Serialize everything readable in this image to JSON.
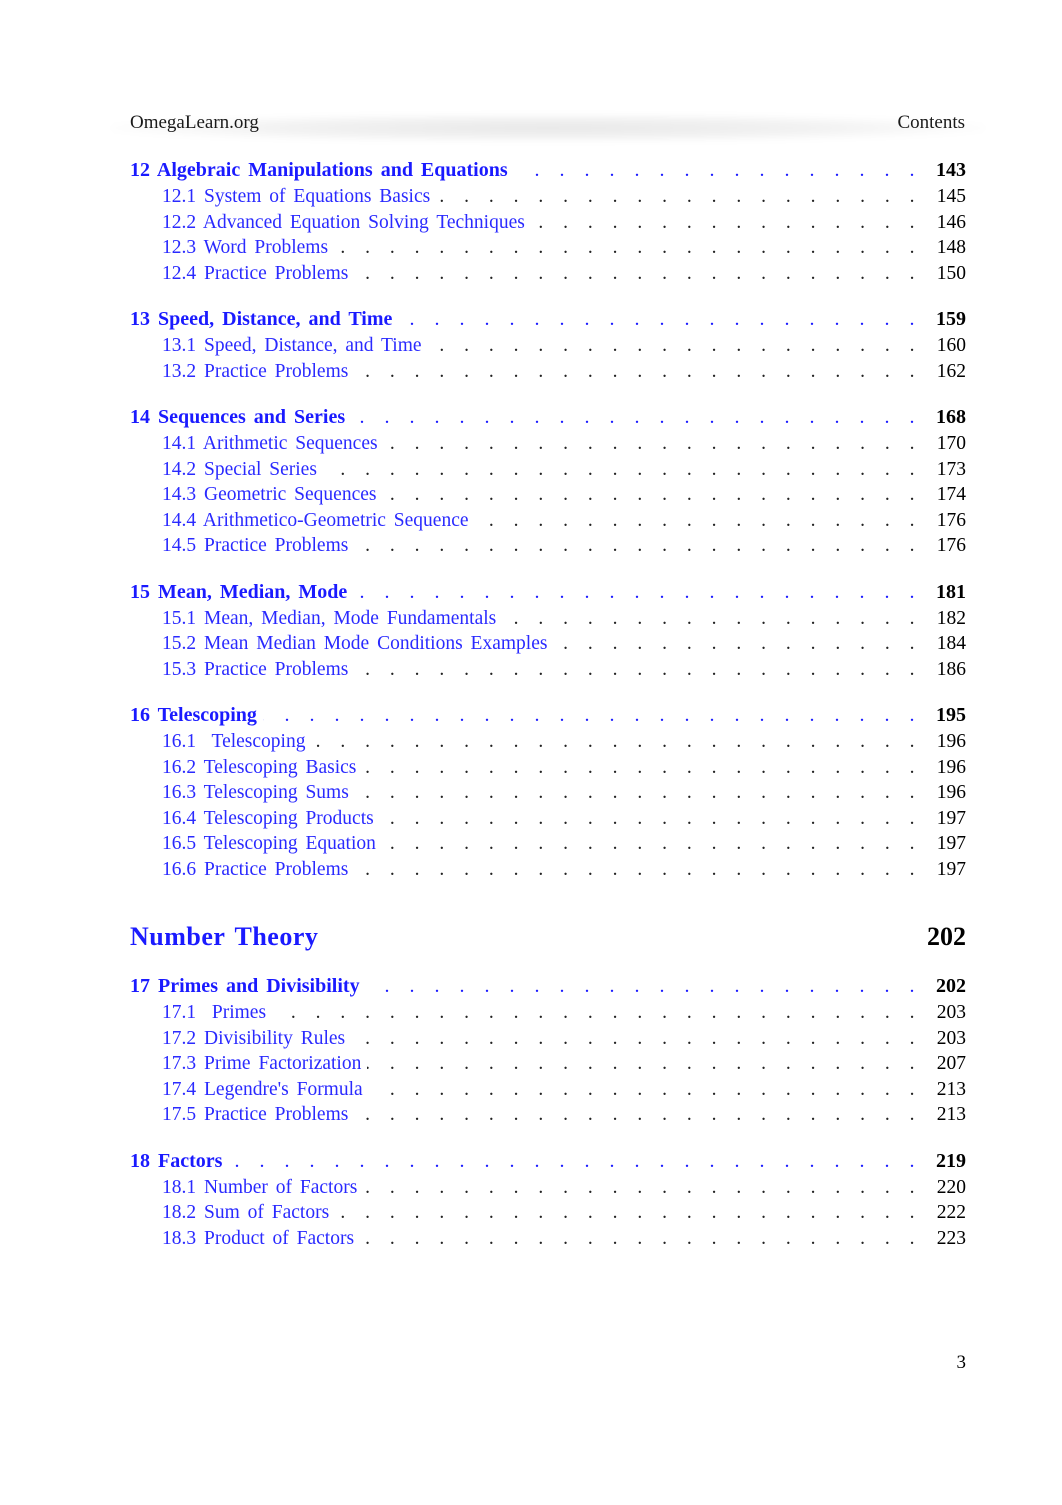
{
  "header": {
    "left": "OmegaLearn.org",
    "right": "Contents"
  },
  "blocks": [
    {
      "type": "chapter",
      "title": "12 Algebraic Manipulations and Equations",
      "page": "143",
      "sections": [
        {
          "title": "12.1 System of Equations Basics",
          "page": "145"
        },
        {
          "title": "12.2 Advanced Equation Solving Techniques",
          "page": "146"
        },
        {
          "title": "12.3 Word Problems",
          "page": "148"
        },
        {
          "title": "12.4 Practice Problems",
          "page": "150"
        }
      ]
    },
    {
      "type": "chapter",
      "title": "13 Speed, Distance, and Time",
      "page": "159",
      "sections": [
        {
          "title": "13.1 Speed, Distance, and Time",
          "page": "160"
        },
        {
          "title": "13.2 Practice Problems",
          "page": "162"
        }
      ]
    },
    {
      "type": "chapter",
      "title": "14 Sequences and Series",
      "page": "168",
      "sections": [
        {
          "title": "14.1 Arithmetic Sequences",
          "page": "170"
        },
        {
          "title": "14.2 Special Series",
          "page": "173"
        },
        {
          "title": "14.3 Geometric Sequences",
          "page": "174"
        },
        {
          "title": "14.4 Arithmetico-Geometric Sequence",
          "page": "176"
        },
        {
          "title": "14.5 Practice Problems",
          "page": "176"
        }
      ]
    },
    {
      "type": "chapter",
      "title": "15 Mean, Median, Mode",
      "page": "181",
      "sections": [
        {
          "title": "15.1 Mean, Median, Mode Fundamentals",
          "page": "182"
        },
        {
          "title": "15.2 Mean Median Mode Conditions Examples",
          "page": "184"
        },
        {
          "title": "15.3 Practice Problems",
          "page": "186"
        }
      ]
    },
    {
      "type": "chapter",
      "title": "16 Telescoping",
      "page": "195",
      "sections": [
        {
          "title": "16.1  Telescoping",
          "page": "196"
        },
        {
          "title": "16.2 Telescoping Basics",
          "page": "196"
        },
        {
          "title": "16.3 Telescoping Sums",
          "page": "196"
        },
        {
          "title": "16.4 Telescoping Products",
          "page": "197"
        },
        {
          "title": "16.5 Telescoping Equation",
          "page": "197"
        },
        {
          "title": "16.6 Practice Problems",
          "page": "197"
        }
      ]
    },
    {
      "type": "part",
      "title": "Number Theory",
      "page": "202"
    },
    {
      "type": "chapter",
      "title": "17 Primes and Divisibility",
      "page": "202",
      "sections": [
        {
          "title": "17.1  Primes",
          "page": "203"
        },
        {
          "title": "17.2 Divisibility Rules",
          "page": "203"
        },
        {
          "title": "17.3 Prime Factorization",
          "page": "207"
        },
        {
          "title": "17.4 Legendre's Formula",
          "page": "213"
        },
        {
          "title": "17.5 Practice Problems",
          "page": "213"
        }
      ]
    },
    {
      "type": "chapter",
      "title": "18 Factors",
      "page": "219",
      "sections": [
        {
          "title": "18.1 Number of Factors",
          "page": "220"
        },
        {
          "title": "18.2 Sum of Factors",
          "page": "222"
        },
        {
          "title": "18.3 Product of Factors",
          "page": "223"
        }
      ]
    }
  ],
  "footer": {
    "page_number": "3"
  }
}
